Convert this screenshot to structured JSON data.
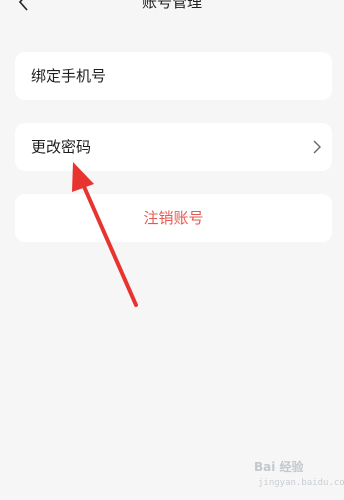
{
  "header": {
    "title": "账号管理",
    "back_icon": "chevron-left-icon"
  },
  "settings": {
    "bind_phone_label": "绑定手机号",
    "change_password_label": "更改密码",
    "change_password_icon": "chevron-right-icon",
    "cancel_account_label": "注销账号"
  },
  "colors": {
    "background": "#f6f6f6",
    "card": "#ffffff",
    "danger_text": "#e55a4e",
    "annotation_arrow": "#e8342f"
  },
  "watermark": {
    "text": "Bai 经验",
    "url": "jingyan.baidu.com"
  }
}
